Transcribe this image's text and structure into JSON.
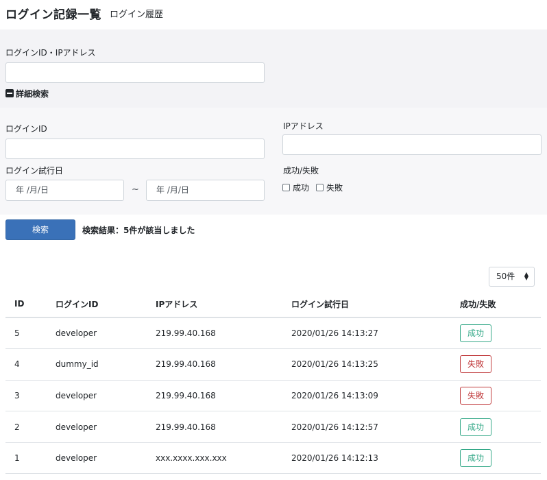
{
  "header": {
    "title": "ログイン記録一覧",
    "subtitle": "ログイン履歴"
  },
  "search": {
    "main_label": "ログインID・IPアドレス",
    "main_value": "",
    "toggle_label": "詳細検索",
    "login_id_label": "ログインID",
    "login_id_value": "",
    "ip_label": "IPアドレス",
    "ip_value": "",
    "date_label": "ログイン試行日",
    "date_from_placeholder": "年 /月/日",
    "date_sep": "~",
    "date_to_placeholder": "年 /月/日",
    "status_label": "成功/失敗",
    "status_options": [
      "成功",
      "失敗"
    ],
    "button_label": "検索",
    "result_text": "検索結果：5件が該当しました"
  },
  "pagination": {
    "per_page": "50件"
  },
  "table": {
    "headers": [
      "ID",
      "ログインID",
      "IPアドレス",
      "ログイン試行日",
      "成功/失敗"
    ],
    "rows": [
      {
        "id": "5",
        "login_id": "developer",
        "ip": "219.99.40.168",
        "date": "2020/01/26 14:13:27",
        "status": "成功",
        "status_type": "success"
      },
      {
        "id": "4",
        "login_id": "dummy_id",
        "ip": "219.99.40.168",
        "date": "2020/01/26 14:13:25",
        "status": "失敗",
        "status_type": "fail"
      },
      {
        "id": "3",
        "login_id": "developer",
        "ip": "219.99.40.168",
        "date": "2020/01/26 14:13:09",
        "status": "失敗",
        "status_type": "fail"
      },
      {
        "id": "2",
        "login_id": "developer",
        "ip": "219.99.40.168",
        "date": "2020/01/26 14:12:57",
        "status": "成功",
        "status_type": "success"
      },
      {
        "id": "1",
        "login_id": "developer",
        "ip": "xxx.xxxx.xxx.xxx",
        "date": "2020/01/26 14:12:13",
        "status": "成功",
        "status_type": "success"
      }
    ]
  },
  "colors": {
    "primary": "#3a71b8",
    "success": "#31a786",
    "fail": "#c0393b",
    "panel": "#f3f3f6"
  },
  "icons": {
    "toggle": "minus-square-icon",
    "select": "updown-arrows-icon",
    "checkbox": "checkbox-icon"
  }
}
